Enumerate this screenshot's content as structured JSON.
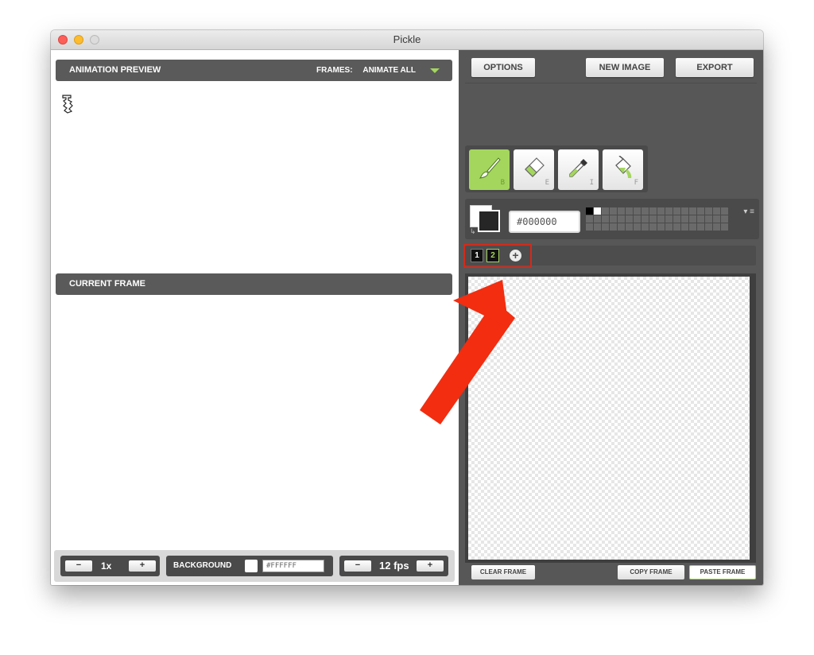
{
  "window": {
    "title": "Pickle"
  },
  "left": {
    "preview_title": "ANIMATION PREVIEW",
    "frames_label": "FRAMES:",
    "frames_value": "ANIMATE ALL",
    "current_frame_title": "CURRENT FRAME",
    "zoom": {
      "minus": "−",
      "value": "1x",
      "plus": "+"
    },
    "background": {
      "label": "BACKGROUND",
      "value": "#FFFFFF"
    },
    "fps": {
      "minus": "−",
      "value": "12 fps",
      "plus": "+"
    }
  },
  "right": {
    "options_label": "OPTIONS",
    "new_image_label": "NEW IMAGE",
    "export_label": "EXPORT",
    "tools": [
      {
        "name": "brush",
        "key": "B",
        "active": true
      },
      {
        "name": "eraser",
        "key": "E",
        "active": false
      },
      {
        "name": "eyedropper",
        "key": "I",
        "active": false
      },
      {
        "name": "fill",
        "key": "F",
        "active": false
      }
    ],
    "color_hex": "#000000",
    "frames": [
      "1",
      "2"
    ],
    "active_frame": "2",
    "add_frame": "+",
    "clear_frame_label": "CLEAR FRAME",
    "copy_frame_label": "COPY FRAME",
    "paste_frame_label": "PASTE FRAME"
  },
  "colors": {
    "accent": "#a4d65e",
    "panel": "#575758",
    "annotation": "#d42a1a"
  }
}
